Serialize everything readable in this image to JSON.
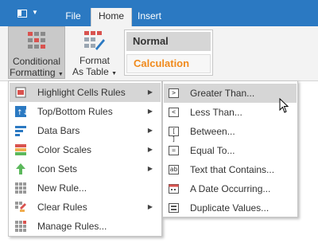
{
  "tabs": [
    "File",
    "Home",
    "Insert"
  ],
  "ribbon": {
    "conditional_formatting": {
      "line1": "Conditional",
      "line2": "Formatting"
    },
    "format_as_table": {
      "line1": "Format",
      "line2": "As Table"
    },
    "cell_styles": [
      "Normal",
      "Calculation"
    ]
  },
  "menu": {
    "items": [
      {
        "label": "Highlight Cells Rules",
        "icon": "highlight-cells-icon",
        "submenu": true
      },
      {
        "label": "Top/Bottom Rules",
        "icon": "top-bottom-icon",
        "submenu": true
      },
      {
        "label": "Data Bars",
        "icon": "data-bars-icon",
        "submenu": true
      },
      {
        "label": "Color Scales",
        "icon": "color-scales-icon",
        "submenu": true
      },
      {
        "label": "Icon Sets",
        "icon": "arrow-up-icon",
        "submenu": true
      },
      {
        "label": "New Rule...",
        "icon": "new-rule-icon",
        "submenu": false
      },
      {
        "label": "Clear Rules",
        "icon": "clear-rules-icon",
        "submenu": true
      },
      {
        "label": "Manage Rules...",
        "icon": "manage-rules-icon",
        "submenu": false
      }
    ]
  },
  "submenu": {
    "items": [
      {
        "label": "Greater Than...",
        "icon": ">"
      },
      {
        "label": "Less Than...",
        "icon": "<"
      },
      {
        "label": "Between...",
        "icon": "[ ]"
      },
      {
        "label": "Equal To...",
        "icon": "="
      },
      {
        "label": "Text that Contains...",
        "icon": "ab"
      },
      {
        "label": "A Date Occurring...",
        "icon": "calendar-icon"
      },
      {
        "label": "Duplicate Values...",
        "icon": "duplicate-icon"
      }
    ]
  },
  "colors": {
    "titlebar": "#2b79c2",
    "calculation_text": "#f08a1c",
    "highlight": "#d6d6d6"
  }
}
